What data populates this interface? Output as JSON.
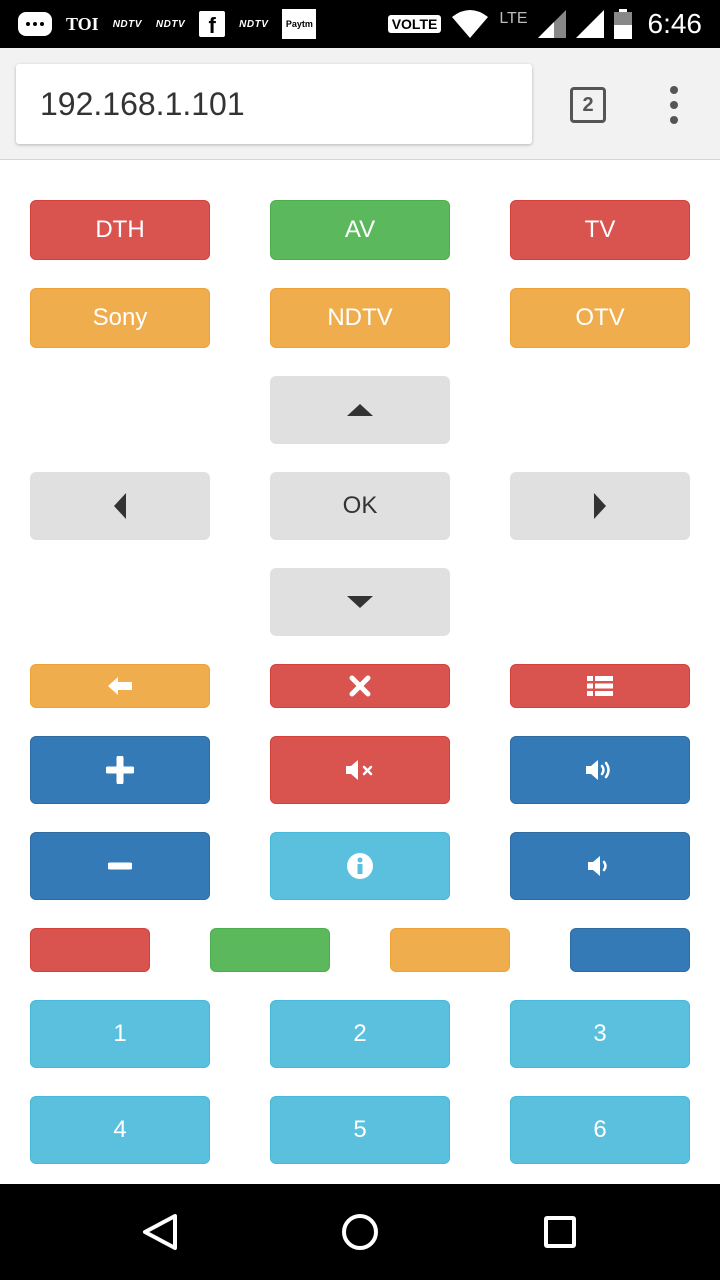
{
  "status_bar": {
    "icons": [
      "chat-icon",
      "facebook-icon",
      "paytm-icon",
      "wifi-icon",
      "signal-icon",
      "battery-icon"
    ],
    "toi": "TOI",
    "ndtv": "NDTV",
    "f": "f",
    "paytm": "Paytm",
    "volte": "VOLTE",
    "lte": "LTE",
    "time": "6:46"
  },
  "browser": {
    "url": "192.168.1.101",
    "tab_count": "2"
  },
  "remote": {
    "sources": {
      "dth": "DTH",
      "av": "AV",
      "tv": "TV"
    },
    "channels": {
      "sony": "Sony",
      "ndtv": "NDTV",
      "otv": "OTV"
    },
    "dpad": {
      "ok": "OK"
    },
    "keypad": [
      "1",
      "2",
      "3",
      "4",
      "5",
      "6"
    ]
  },
  "colors": {
    "red": "#d9534f",
    "green": "#5cb85c",
    "orange": "#f0ad4e",
    "blue": "#337ab7",
    "cyan": "#5bc0de",
    "grey": "#e0e0e0"
  }
}
